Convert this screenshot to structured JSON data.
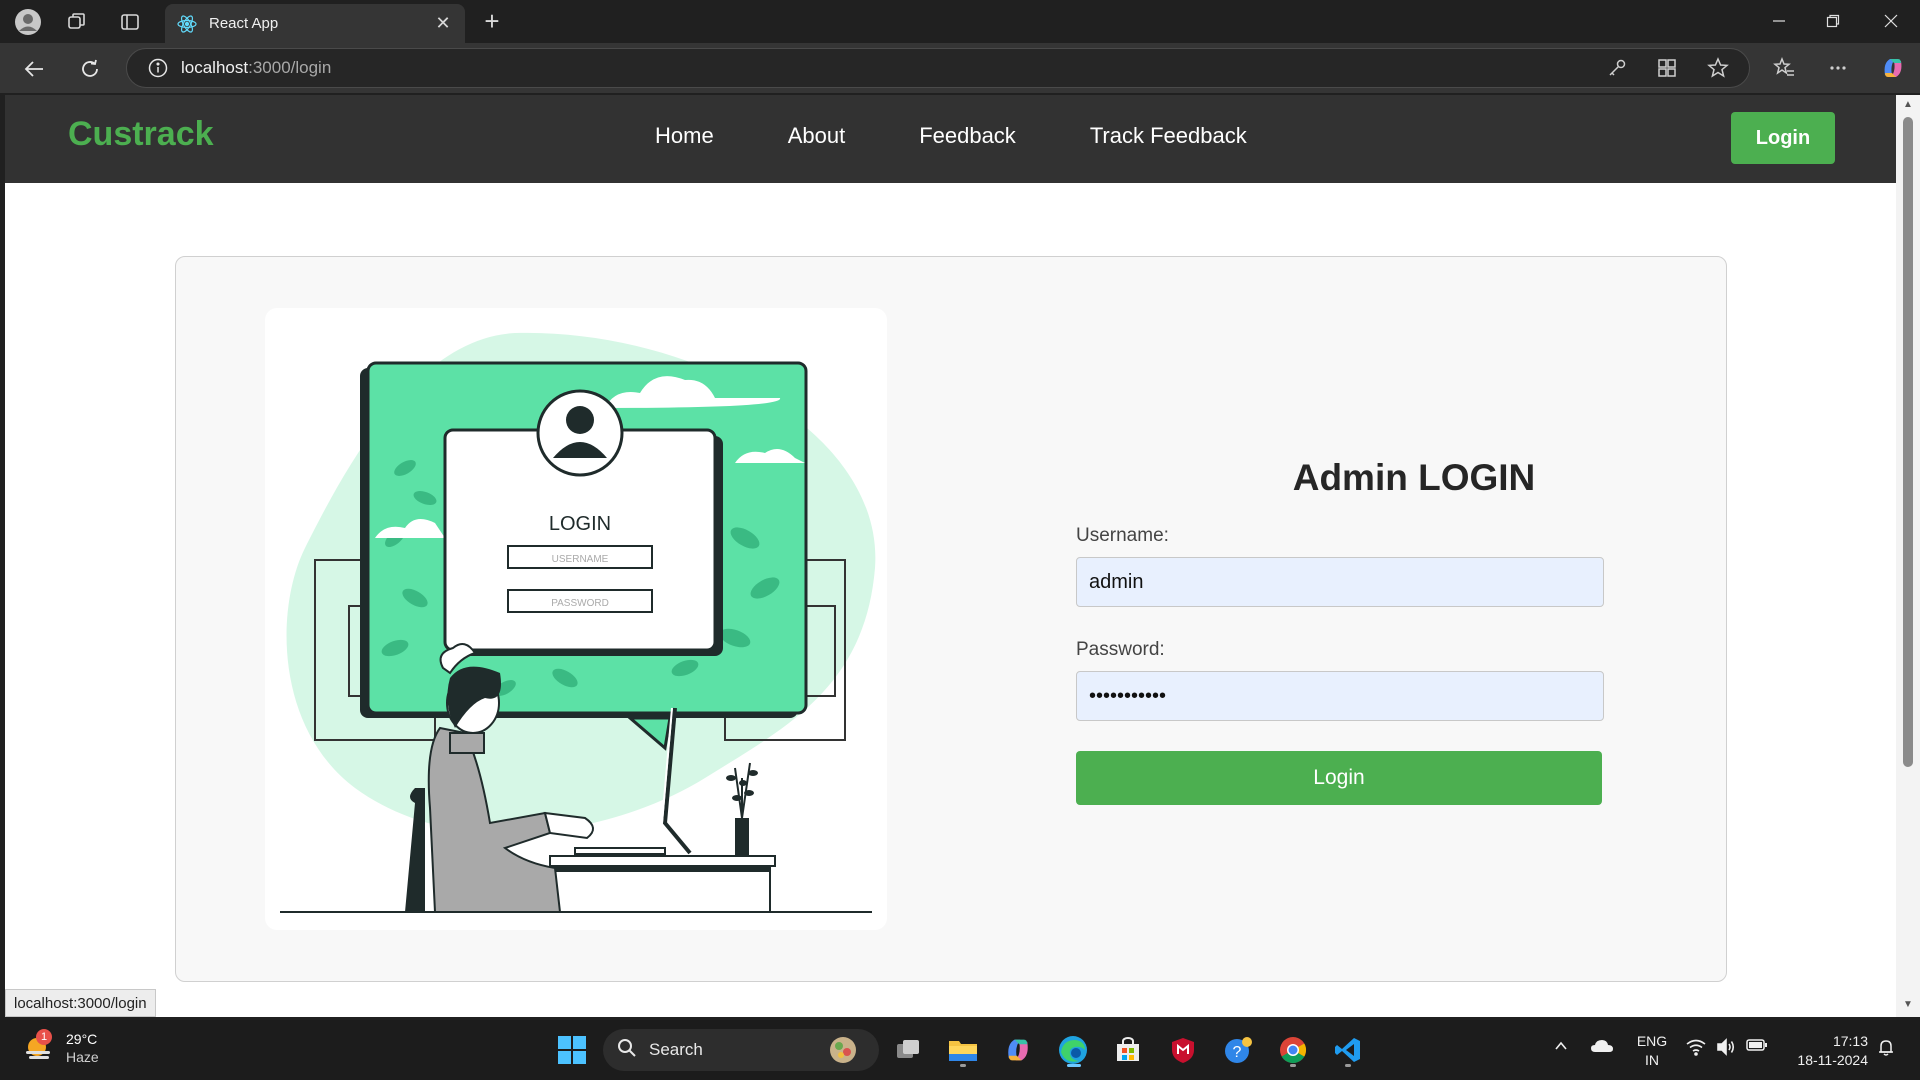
{
  "browser": {
    "tab_title": "React App",
    "url_host": "localhost",
    "url_rest": ":3000/login",
    "status_url": "localhost:3000/login"
  },
  "site": {
    "brand": "Custrack",
    "nav": {
      "home": "Home",
      "about": "About",
      "feedback": "Feedback",
      "track": "Track Feedback"
    },
    "nav_login": "Login"
  },
  "login": {
    "title": "Admin LOGIN",
    "username_label": "Username:",
    "username_value": "admin",
    "password_label": "Password:",
    "password_value": "•••••••••••",
    "submit_label": "Login"
  },
  "illustration": {
    "heading": "LOGIN",
    "username_placeholder": "USERNAME",
    "password_placeholder": "PASSWORD"
  },
  "taskbar": {
    "temperature": "29°C",
    "condition": "Haze",
    "weather_badge": "1",
    "search_label": "Search",
    "lang_top": "ENG",
    "lang_bottom": "IN",
    "time": "17:13",
    "date": "18-11-2024"
  },
  "colors": {
    "accent": "#4caf50",
    "nav_bg": "#323232",
    "illustration_green": "#5ce1a6",
    "illustration_mint": "#d6f7e6"
  }
}
